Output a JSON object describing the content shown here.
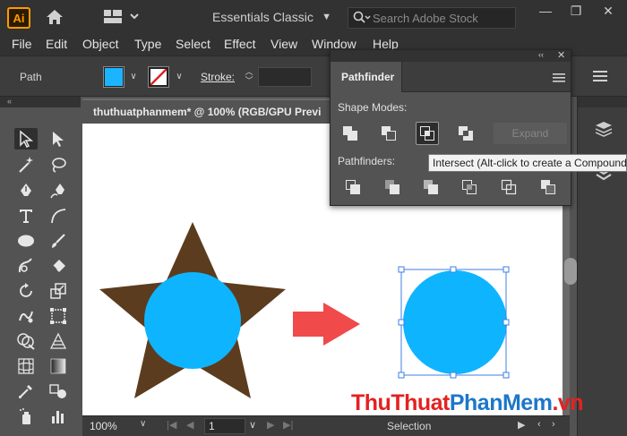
{
  "app": {
    "logo": "Ai",
    "workspace": "Essentials Classic",
    "search_placeholder": "Search Adobe Stock"
  },
  "menu": [
    "File",
    "Edit",
    "Object",
    "Type",
    "Select",
    "Effect",
    "View",
    "Window",
    "Help"
  ],
  "control_bar": {
    "selection_type": "Path",
    "fill_color": "#1ab4ff",
    "stroke_label": "Stroke:"
  },
  "document": {
    "tab_title": "thuthuatphanmem* @ 100% (RGB/GPU Previ"
  },
  "pathfinder": {
    "tab": "Pathfinder",
    "shape_modes_label": "Shape Modes:",
    "pathfinders_label": "Pathfinders:",
    "expand_label": "Expand",
    "shape_mode_buttons": [
      "unite-icon",
      "minus-front-icon",
      "intersect-icon",
      "exclude-icon"
    ],
    "pathfinder_buttons": [
      "divide-icon",
      "trim-icon",
      "merge-icon",
      "crop-icon",
      "outline-icon",
      "minus-back-icon"
    ],
    "tooltip": "Intersect (Alt-click to create a Compound S"
  },
  "status_bar": {
    "zoom": "100%",
    "artboard": "1",
    "status": "Selection"
  },
  "artwork": {
    "star_color": "#5c3c1e",
    "circle_color": "#0fb4ff",
    "arrow_color": "#f04a4a",
    "selection_color": "#3d7fe6"
  },
  "watermark": {
    "part1": "ThuThuat",
    "part2": "PhanMem",
    "part3": ".vn"
  }
}
